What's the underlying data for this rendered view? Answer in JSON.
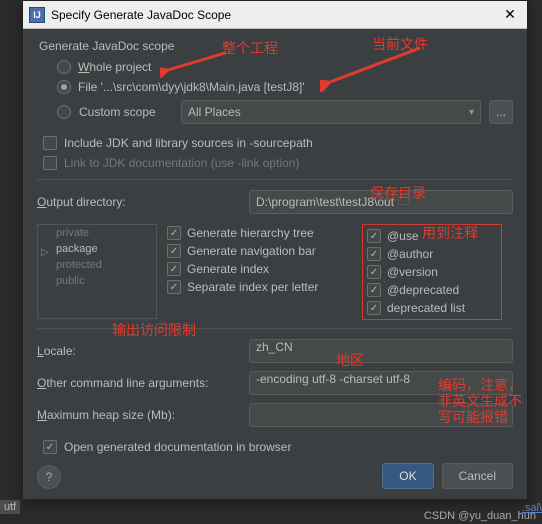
{
  "titlebar": {
    "title": "Specify Generate JavaDoc Scope",
    "icon_text": "IJ"
  },
  "scope": {
    "group_label": "Generate JavaDoc scope",
    "whole_project": "Whole project",
    "file": "File '...\\src\\com\\dyy\\jdk8\\Main.java [testJ8]'",
    "custom_scope": "Custom scope",
    "all_places": "All Places",
    "dots": "..."
  },
  "checks": {
    "include_jdk": "Include JDK and library sources in -sourcepath",
    "link_jdk": "Link to JDK documentation (use -link option)"
  },
  "output": {
    "label": "Output directory:",
    "value": "D:\\program\\test\\testJ8\\out"
  },
  "access": {
    "private": "private",
    "package": "package",
    "protected": "protected",
    "public": "public"
  },
  "gen": {
    "hierarchy": "Generate hierarchy tree",
    "nav": "Generate navigation bar",
    "index": "Generate index",
    "sep_index": "Separate index per letter"
  },
  "tags": {
    "use": "@use",
    "author": "@author",
    "version": "@version",
    "deprecated": "@deprecated",
    "deplist": "deprecated list"
  },
  "locale": {
    "label": "Locale:",
    "value": "zh_CN"
  },
  "args": {
    "label": "Other command line arguments:",
    "value": "-encoding utf-8 -charset utf-8"
  },
  "heap": {
    "label": "Maximum heap size (Mb):",
    "value": ""
  },
  "open_doc": "Open generated documentation in browser",
  "buttons": {
    "ok": "OK",
    "cancel": "Cancel",
    "help": "?"
  },
  "annotations": {
    "whole_project": "整个工程",
    "current_file": "当前文件",
    "save_dir": "保存目录",
    "to_annotation": "用到注释",
    "access_restrict": "输出访问限制",
    "region": "地区",
    "encoding_note": "编码，注意，\n非英文生成不\n写可能报错"
  },
  "watermark": "CSDN @yu_duan_hun",
  "edge": {
    "utf": "utf",
    "link": ".sal\\"
  }
}
